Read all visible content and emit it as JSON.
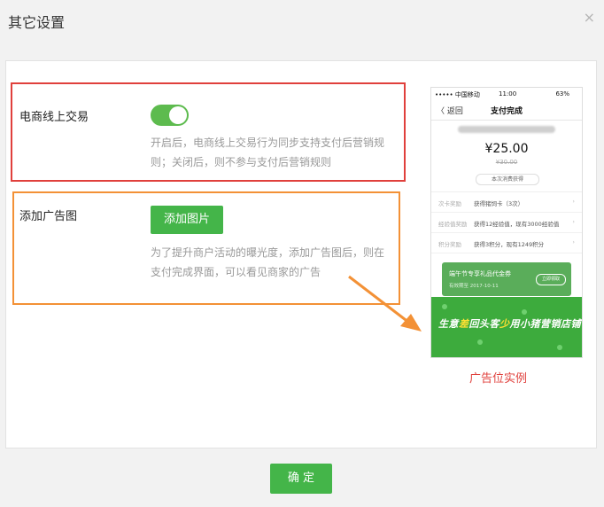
{
  "dialog": {
    "title": "其它设置",
    "close_icon": "×",
    "confirm_label": "确 定"
  },
  "ecommerce": {
    "label": "电商线上交易",
    "toggle_on": true,
    "desc_line1": "开启后，电商线上交易行为同步支持支付后营销规",
    "desc_line2": "则；关闭后，则不参与支付后营销规则"
  },
  "ad_image": {
    "label": "添加广告图",
    "button_label": "添加图片",
    "desc_line1": "为了提升商户活动的曝光度，添加广告图后，则在",
    "desc_line2": "支付完成界面，可以看见商家的广告"
  },
  "preview": {
    "caption": "广告位实例",
    "status_carrier": "••••• 中国移动 ",
    "status_time": "11:00",
    "status_battery": "63%",
    "back_label": "〈 返回",
    "page_title": "支付完成",
    "amount": "¥25.00",
    "original_amount": "¥30.00",
    "reward_pill": "本次消费获得",
    "rows": [
      {
        "key": "次卡奖励",
        "value": "获得猪饲卡（3次）"
      },
      {
        "key": "经验值奖励",
        "value": "获得12经验值，现有3000经验值"
      },
      {
        "key": "积分奖励",
        "value": "获得3积分，现有1249积分"
      }
    ],
    "coupon_title": "端午节专享礼品代金券",
    "coupon_date": "有效期至 2017-10-11",
    "coupon_button": "立即领取",
    "ad_text_a": "生意",
    "ad_text_hl1": "差",
    "ad_text_b": "回头客",
    "ad_text_hl2": "少",
    "ad_text_c": "用小猪营销店铺"
  },
  "colors": {
    "accent_green": "#44b549",
    "red_frame": "#e0403c",
    "orange_frame": "#f39136"
  }
}
